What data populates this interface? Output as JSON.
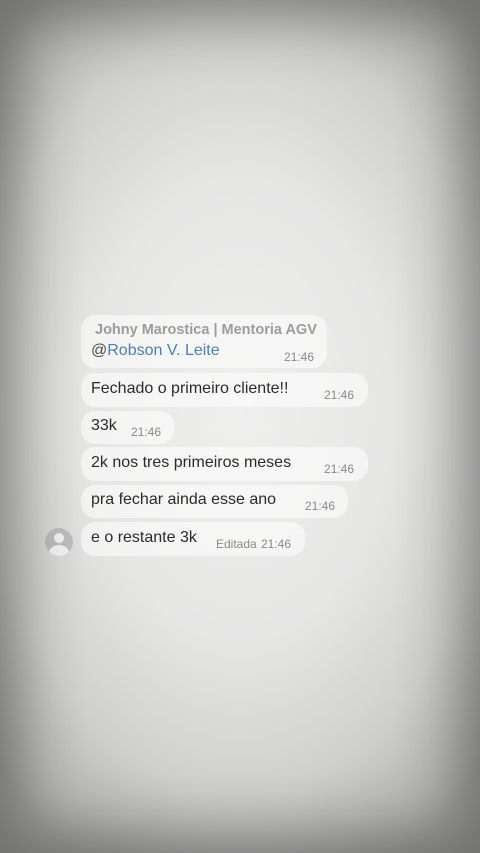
{
  "chat": {
    "sender_name": "Johny Marostica | Mentoria AGV",
    "messages": [
      {
        "at": "@",
        "mention": "Robson V. Leite",
        "time": "21:46"
      },
      {
        "text": "Fechado o primeiro cliente!!",
        "time": "21:46"
      },
      {
        "text": "33k",
        "time": "21:46"
      },
      {
        "text": "2k nos tres primeiros meses",
        "time": "21:46"
      },
      {
        "text": "pra fechar ainda esse ano",
        "time": "21:46"
      },
      {
        "text": "e o restante 3k",
        "edited_label": "Editada",
        "time": "21:46"
      }
    ]
  },
  "avatar": {
    "icon": "user-avatar-icon"
  }
}
